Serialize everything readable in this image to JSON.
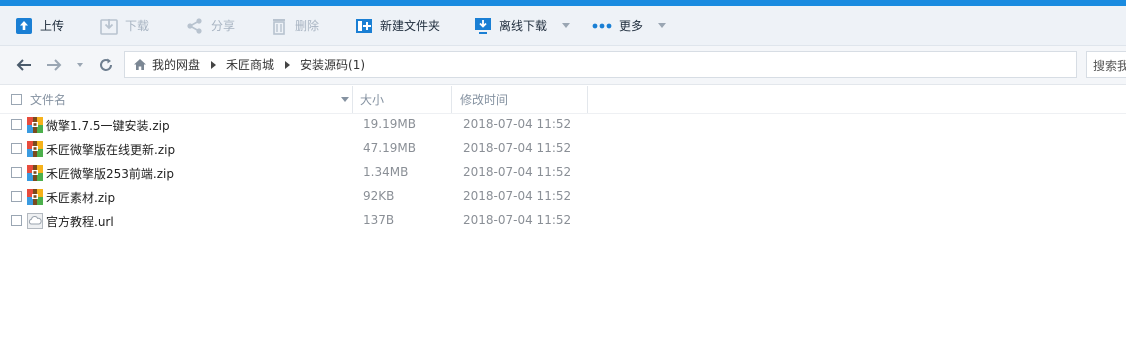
{
  "toolbar": {
    "upload": "上传",
    "download": "下载",
    "share": "分享",
    "delete": "删除",
    "new_folder": "新建文件夹",
    "offline_download": "离线下载",
    "more": "更多"
  },
  "address": {
    "crumbs": [
      "我的网盘",
      "禾匠商城",
      "安装源码(1)"
    ],
    "search_placeholder": "搜索我的网盘"
  },
  "columns": {
    "name": "文件名",
    "size": "大小",
    "modified": "修改时间"
  },
  "files": [
    {
      "name": "微擎1.7.5一键安装.zip",
      "size": "19.19MB",
      "modified": "2018-07-04 11:52",
      "icon": "zip-archive-icon"
    },
    {
      "name": "禾匠微擎版在线更新.zip",
      "size": "47.19MB",
      "modified": "2018-07-04 11:52",
      "icon": "zip-archive-icon"
    },
    {
      "name": "禾匠微擎版253前端.zip",
      "size": "1.34MB",
      "modified": "2018-07-04 11:52",
      "icon": "zip-archive-icon"
    },
    {
      "name": "禾匠素材.zip",
      "size": "92KB",
      "modified": "2018-07-04 11:52",
      "icon": "zip-archive-icon"
    },
    {
      "name": "官方教程.url",
      "size": "137B",
      "modified": "2018-07-04 11:52",
      "icon": "url-cloud-icon"
    }
  ],
  "colors": {
    "accent": "#1a8be0",
    "toolbar_bg": "#eef2f7",
    "disabled": "#a8b4c2"
  }
}
